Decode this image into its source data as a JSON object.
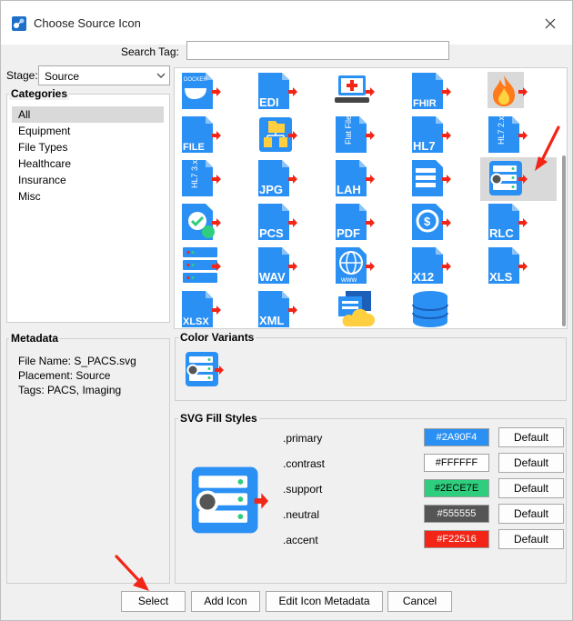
{
  "window": {
    "title": "Choose Source Icon"
  },
  "search": {
    "label": "Search Tag:",
    "value": ""
  },
  "stage": {
    "label": "Stage:",
    "value": "Source"
  },
  "categories": {
    "title": "Categories",
    "items": [
      "All",
      "Equipment",
      "File Types",
      "Healthcare",
      "Insurance",
      "Misc"
    ],
    "selected": "All"
  },
  "icons": [
    {
      "name": "docker",
      "label": "DOCKER"
    },
    {
      "name": "edi",
      "label": "EDI"
    },
    {
      "name": "medical-laptop",
      "label": ""
    },
    {
      "name": "fhir",
      "label": "FHIR"
    },
    {
      "name": "fire",
      "label": ""
    },
    {
      "name": "file",
      "label": "FILE"
    },
    {
      "name": "folder-split",
      "label": ""
    },
    {
      "name": "flat-file",
      "label": "Flat File"
    },
    {
      "name": "hl7",
      "label": "HL7"
    },
    {
      "name": "hl7-2x",
      "label": "HL7 2.x"
    },
    {
      "name": "hl7-3x",
      "label": "HL7 3.x"
    },
    {
      "name": "jpg",
      "label": "JPG"
    },
    {
      "name": "lah",
      "label": "LAH"
    },
    {
      "name": "server-list",
      "label": ""
    },
    {
      "name": "pacs",
      "label": ""
    },
    {
      "name": "insurance-check",
      "label": ""
    },
    {
      "name": "pcs",
      "label": "PCS"
    },
    {
      "name": "pdf",
      "label": "PDF"
    },
    {
      "name": "payment-cycle",
      "label": ""
    },
    {
      "name": "rlc",
      "label": "RLC"
    },
    {
      "name": "server-rack",
      "label": ""
    },
    {
      "name": "wav",
      "label": "WAV"
    },
    {
      "name": "www",
      "label": "www"
    },
    {
      "name": "x12",
      "label": "X12"
    },
    {
      "name": "xls",
      "label": "XLS"
    },
    {
      "name": "xlsx",
      "label": "XLSX"
    },
    {
      "name": "xml",
      "label": "XML"
    },
    {
      "name": "cloud-windows",
      "label": ""
    },
    {
      "name": "database",
      "label": ""
    }
  ],
  "selected_icon": "pacs",
  "metadata": {
    "title": "Metadata",
    "file_name": "File Name: S_PACS.svg",
    "placement": "Placement: Source",
    "tags": "Tags: PACS, Imaging"
  },
  "color_variants": {
    "title": "Color Variants"
  },
  "svg_fill_styles": {
    "title": "SVG Fill Styles",
    "rows": [
      {
        "name": ".primary",
        "value": "#2A90F4",
        "fg": "#ffffff",
        "default_label": "Default"
      },
      {
        "name": ".contrast",
        "value": "#FFFFFF",
        "fg": "#000000",
        "default_label": "Default"
      },
      {
        "name": ".support",
        "value": "#2ECE7E",
        "fg": "#000000",
        "default_label": "Default"
      },
      {
        "name": ".neutral",
        "value": "#555555",
        "fg": "#ffffff",
        "default_label": "Default"
      },
      {
        "name": ".accent",
        "value": "#F22516",
        "fg": "#ffffff",
        "default_label": "Default"
      }
    ]
  },
  "buttons": {
    "select": "Select",
    "add_icon": "Add Icon",
    "edit_metadata": "Edit Icon Metadata",
    "cancel": "Cancel"
  },
  "colors": {
    "icon_blue": "#2A90F4",
    "arrow_red": "#F22516",
    "support_green": "#2ECE7E"
  }
}
